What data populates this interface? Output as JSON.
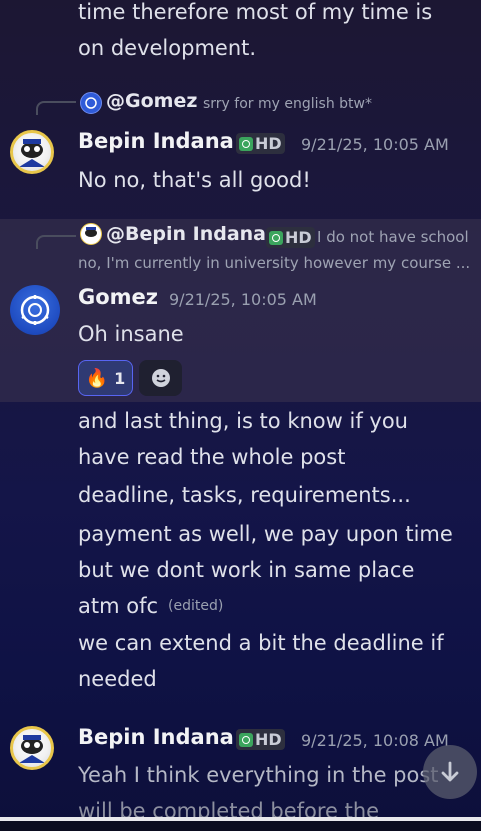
{
  "messages_top": {
    "line1": "time therefore most of my time is",
    "line2": "on development."
  },
  "reply1": {
    "mention": "@Gomez",
    "preview": "srry for my english btw*"
  },
  "msg_bepin_1": {
    "author": "Bepin Indana",
    "badge": "HD",
    "timestamp": "9/21/25, 10:05 AM",
    "text": "No no, that's all good!"
  },
  "reply2": {
    "mention": "@Bepin Indana",
    "badge": "HD",
    "preview_line1": "I do not have school",
    "preview_line2": "no, I'm currently in university however my course ..."
  },
  "msg_gomez": {
    "author": "Gomez",
    "timestamp": "9/21/25, 10:05 AM",
    "text": "Oh insane",
    "reaction_fire_count": "1",
    "reaction_fire_emoji": "🔥"
  },
  "gomez_followups": {
    "p1_line1": "and last thing, is to know if you",
    "p1_line2": "have read the whole post",
    "p2": "deadline, tasks, requirements...",
    "p3_line1": "payment as well, we pay upon time",
    "p3_line2": "but we dont work in same place",
    "p3_line3": "atm ofc",
    "edited": "(edited)",
    "p4_line1": "we can extend a bit the deadline if",
    "p4_line2": "needed"
  },
  "msg_bepin_2": {
    "author": "Bepin Indana",
    "badge": "HD",
    "timestamp": "9/21/25, 10:08 AM",
    "text_line1": "Yeah I think everything in the post",
    "text_line2": "will be completed before the"
  },
  "icons": {
    "scroll_down": "arrow-down-icon",
    "add_reaction": "smiley-add-reaction-icon",
    "hd_badge": "hd-badge-icon"
  },
  "colors": {
    "accent_green": "#3ba55d",
    "reaction_active_bg": "#2f3a73",
    "reaction_active_border": "#5865f2"
  }
}
